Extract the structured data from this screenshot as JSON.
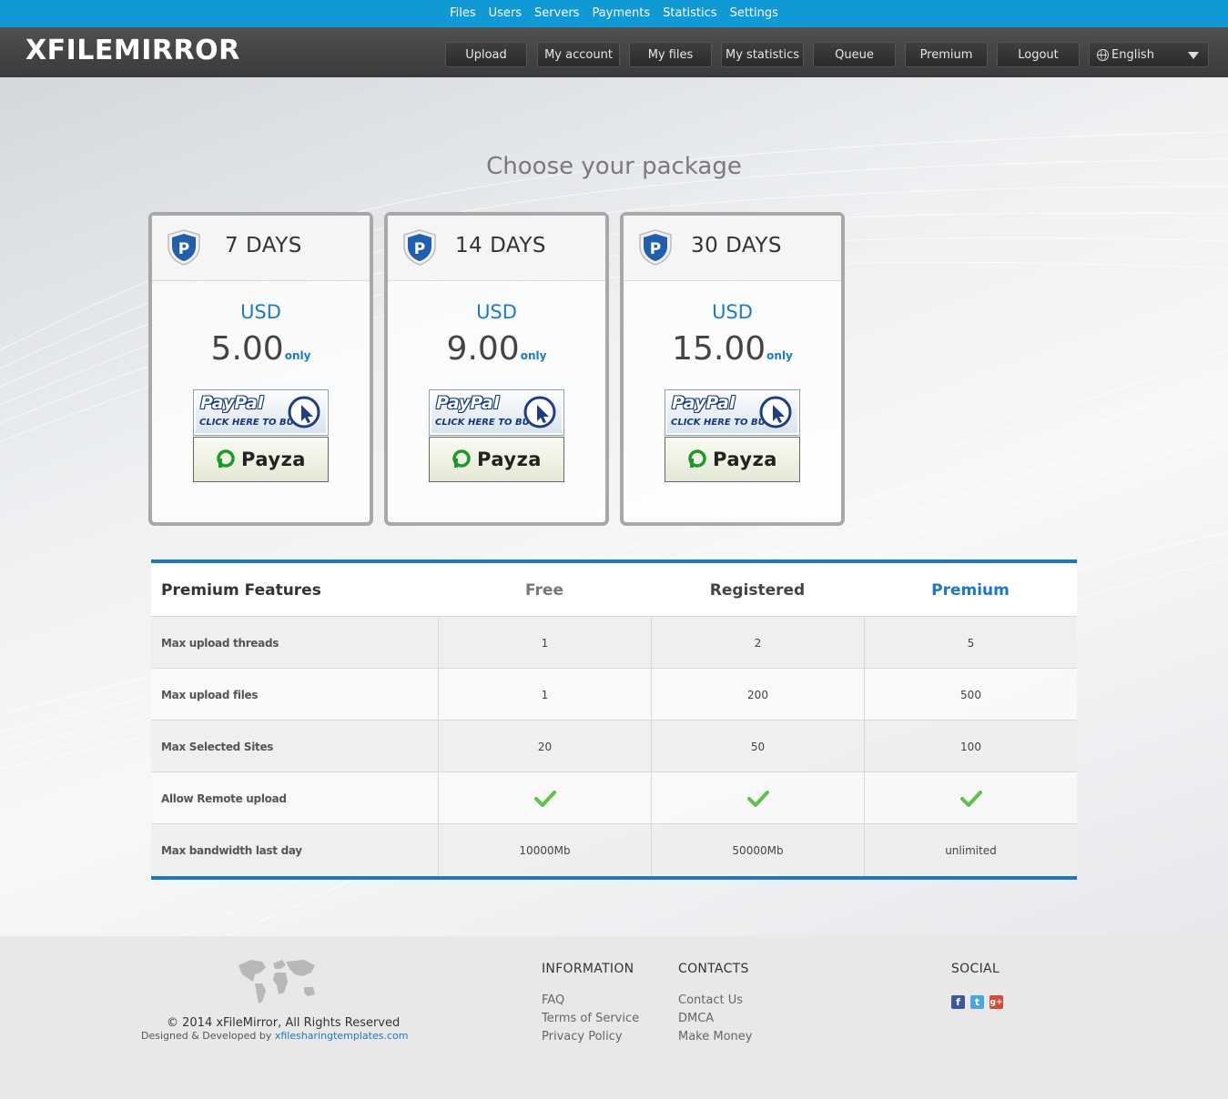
{
  "admin_nav": [
    "Files",
    "Users",
    "Servers",
    "Payments",
    "Statistics",
    "Settings"
  ],
  "logo": "XFILEMIRROR",
  "user_nav": [
    "Upload",
    "My account",
    "My files",
    "My statistics",
    "Queue",
    "Premium",
    "Logout"
  ],
  "language": "English",
  "page_title": "Choose your package",
  "packages": [
    {
      "days": "7 DAYS",
      "currency": "USD",
      "price": "5.00",
      "suffix": "only"
    },
    {
      "days": "14 DAYS",
      "currency": "USD",
      "price": "9.00",
      "suffix": "only"
    },
    {
      "days": "30 DAYS",
      "currency": "USD",
      "price": "15.00",
      "suffix": "only"
    }
  ],
  "payment": {
    "paypal_logo": "PayPal",
    "paypal_sub": "CLICK HERE TO BUY",
    "payza": "Payza"
  },
  "features": {
    "headers": [
      "Premium Features",
      "Free",
      "Registered",
      "Premium"
    ],
    "rows": [
      {
        "label": "Max upload threads",
        "values": [
          "1",
          "2",
          "5"
        ]
      },
      {
        "label": "Max upload files",
        "values": [
          "1",
          "200",
          "500"
        ]
      },
      {
        "label": "Max Selected Sites",
        "values": [
          "20",
          "50",
          "100"
        ]
      },
      {
        "label": "Allow Remote upload",
        "values": [
          "check",
          "check",
          "check"
        ]
      },
      {
        "label": "Max bandwidth last day",
        "values": [
          "10000Mb",
          "50000Mb",
          "unlimited"
        ]
      }
    ]
  },
  "footer": {
    "copyright": "© 2014 xFileMirror, All Rights Reserved",
    "designed_prefix": "Designed & Developed by ",
    "designed_link": "xfilesharingtemplates.com",
    "information_title": "INFORMATION",
    "information_links": [
      "FAQ",
      "Terms of Service",
      "Privacy Policy"
    ],
    "contacts_title": "CONTACTS",
    "contacts_links": [
      "Contact Us",
      "DMCA",
      "Make Money"
    ],
    "social_title": "SOCIAL",
    "social_icons": [
      "facebook-icon",
      "twitter-icon",
      "google-plus-icon"
    ]
  },
  "colors": {
    "admin_bar": "#0f9ad6",
    "accent": "#1a78c8",
    "header_bg": "#404040"
  }
}
